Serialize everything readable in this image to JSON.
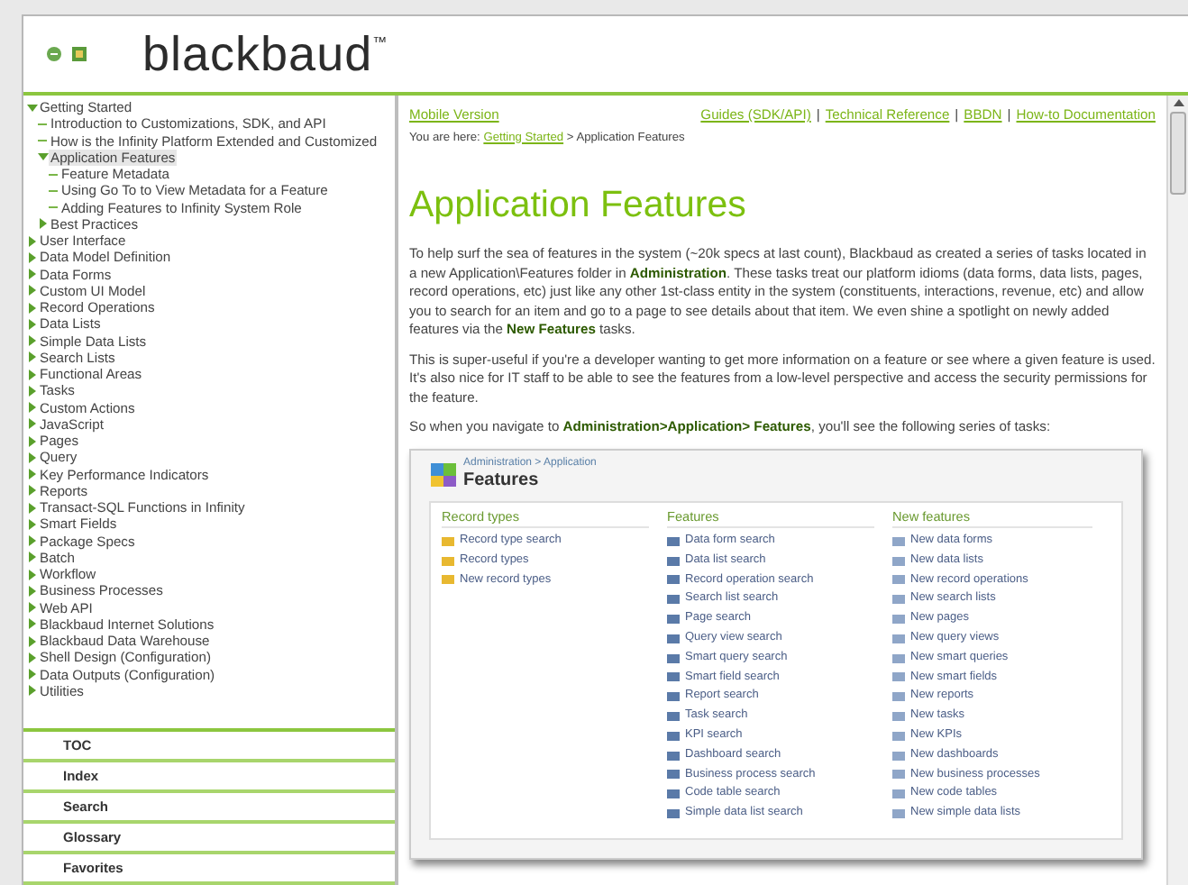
{
  "header": {
    "logo": "blackbaud",
    "logo_mark": "™"
  },
  "toc": [
    {
      "label": "Getting Started",
      "expanded": true,
      "selected": false,
      "children": [
        {
          "label": "Introduction to Customizations, SDK, and API",
          "selected": false
        },
        {
          "label": "How is the Infinity Platform Extended and Customized",
          "selected": false
        },
        {
          "label": "Application Features",
          "expanded": true,
          "selected": true,
          "children": [
            {
              "label": "Feature Metadata",
              "selected": false
            },
            {
              "label": "Using Go To to View Metadata for a Feature",
              "selected": false
            },
            {
              "label": "Adding Features to Infinity System Role",
              "selected": false
            }
          ]
        },
        {
          "label": "Best Practices",
          "expanded": false,
          "selected": false
        }
      ]
    },
    {
      "label": "User Interface",
      "expanded": false,
      "selected": false
    },
    {
      "label": "Data Model Definition",
      "expanded": false,
      "selected": false
    },
    {
      "label": "Data Forms",
      "expanded": false,
      "selected": false
    },
    {
      "label": "Custom UI Model",
      "expanded": false,
      "selected": false
    },
    {
      "label": "Record Operations",
      "expanded": false,
      "selected": false
    },
    {
      "label": "Data Lists",
      "expanded": false,
      "selected": false
    },
    {
      "label": "Simple Data Lists",
      "expanded": false,
      "selected": false
    },
    {
      "label": "Search Lists",
      "expanded": false,
      "selected": false
    },
    {
      "label": "Functional Areas",
      "expanded": false,
      "selected": false
    },
    {
      "label": "Tasks",
      "expanded": false,
      "selected": false
    },
    {
      "label": "Custom Actions",
      "expanded": false,
      "selected": false
    },
    {
      "label": "JavaScript",
      "expanded": false,
      "selected": false
    },
    {
      "label": "Pages",
      "expanded": false,
      "selected": false
    },
    {
      "label": "Query",
      "expanded": false,
      "selected": false
    },
    {
      "label": "Key Performance Indicators",
      "expanded": false,
      "selected": false
    },
    {
      "label": "Reports",
      "expanded": false,
      "selected": false
    },
    {
      "label": "Transact-SQL Functions in Infinity",
      "expanded": false,
      "selected": false
    },
    {
      "label": "Smart Fields",
      "expanded": false,
      "selected": false
    },
    {
      "label": "Package Specs",
      "expanded": false,
      "selected": false
    },
    {
      "label": "Batch",
      "expanded": false,
      "selected": false
    },
    {
      "label": "Workflow",
      "expanded": false,
      "selected": false
    },
    {
      "label": "Business Processes",
      "expanded": false,
      "selected": false
    },
    {
      "label": "Web API",
      "expanded": false,
      "selected": false
    },
    {
      "label": "Blackbaud Internet Solutions",
      "expanded": false,
      "selected": false
    },
    {
      "label": "Blackbaud Data Warehouse",
      "expanded": false,
      "selected": false
    },
    {
      "label": "Shell Design (Configuration)",
      "expanded": false,
      "selected": false
    },
    {
      "label": "Data Outputs (Configuration)",
      "expanded": false,
      "selected": false
    },
    {
      "label": "Utilities",
      "expanded": false,
      "selected": false
    }
  ],
  "nav_tabs": [
    "TOC",
    "Index",
    "Search",
    "Glossary",
    "Favorites"
  ],
  "top_links": {
    "left": "Mobile Version",
    "right": [
      {
        "kind": "link",
        "text": "Guides (SDK/API)"
      },
      {
        "kind": "sep",
        "text": "|"
      },
      {
        "kind": "link",
        "text": "Technical Reference"
      },
      {
        "kind": "sep",
        "text": "|"
      },
      {
        "kind": "link",
        "text": "BBDN"
      },
      {
        "kind": "sep",
        "text": "|"
      },
      {
        "kind": "link",
        "text": "How-to Documentation"
      }
    ]
  },
  "breadcrumb": {
    "prefix": "You are here:",
    "link": "Getting Started",
    "rest": "> Application Features"
  },
  "title": "Application Features",
  "paragraphs": [
    "To help surf the sea of features in the system (~20k specs at last count), Blackbaud as created a series of tasks located in a new Application\\Features folder in **Administration**. These tasks treat our platform idioms (data forms, data lists, pages, record operations, etc) just like any other 1st-class entity in the system (constituents, interactions, revenue, etc) and allow you to search for an item and go to a page to see details about that item. We even shine a spotlight on newly added features via the **New Features** tasks.",
    "This is super-useful if you're a developer wanting to get more information on a feature or see where a given feature is used. It's also nice for IT staff to be able to see the features from a low-level perspective and access the security permissions for the feature.",
    "So when you navigate to **Administration>Application> Features**, you'll see the following series of tasks:"
  ],
  "screenshot": {
    "breadcrumb": "Administration > Application",
    "title": "Features",
    "columns": [
      {
        "heading": "Record types",
        "items": [
          "Record type search",
          "Record types",
          "New record types"
        ]
      },
      {
        "heading": "Features",
        "items": [
          "Data form search",
          "Data list search",
          "Record operation search",
          "Search list search",
          "Page search",
          "Query view search",
          "Smart query search",
          "Smart field search",
          "Report search",
          "Task search",
          "KPI search",
          "Dashboard search",
          "Business process search",
          "Code table search",
          "Simple data list search"
        ]
      },
      {
        "heading": "New features",
        "items": [
          "New data forms",
          "New data lists",
          "New record operations",
          "New search lists",
          "New pages",
          "New query views",
          "New smart queries",
          "New smart fields",
          "New reports",
          "New tasks",
          "New KPIs",
          "New dashboards",
          "New business processes",
          "New code tables",
          "New simple data lists"
        ]
      }
    ]
  }
}
